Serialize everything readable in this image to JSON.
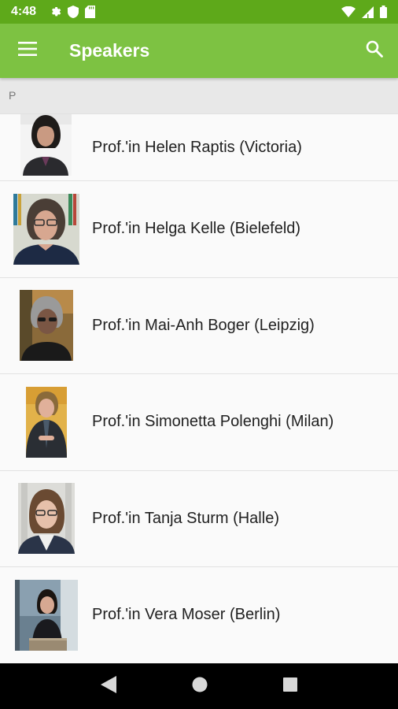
{
  "status_bar": {
    "time": "4:48"
  },
  "app_bar": {
    "title": "Speakers"
  },
  "section": {
    "letter": "P"
  },
  "speakers": [
    {
      "name": "Prof.'in Helen Raptis (Victoria)"
    },
    {
      "name": "Prof.'in Helga Kelle (Bielefeld)"
    },
    {
      "name": "Prof.'in Mai-Anh Boger (Leipzig)"
    },
    {
      "name": "Prof.'in Simonetta Polenghi (Milan)"
    },
    {
      "name": "Prof.'in Tanja Sturm (Halle)"
    },
    {
      "name": "Prof.'in Vera Moser (Berlin)"
    }
  ],
  "colors": {
    "status_bar": "#5ea91a",
    "app_bar": "#7dc242",
    "nav_bar": "#000000"
  },
  "icons": [
    "menu-icon",
    "search-icon",
    "settings-icon",
    "shield-icon",
    "sd-card-icon",
    "wifi-icon",
    "signal-icon",
    "battery-icon",
    "back-icon",
    "home-icon",
    "recents-icon"
  ]
}
